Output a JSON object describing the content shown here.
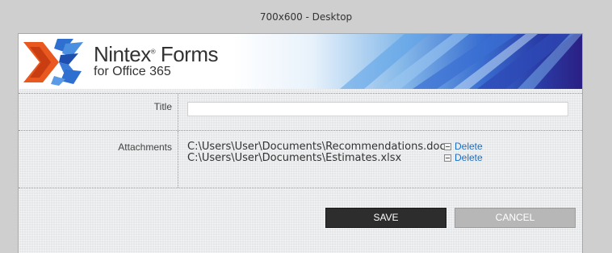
{
  "device_label": "700x600 - Desktop",
  "banner": {
    "brand_title": "Nintex",
    "brand_title_suffix": "Forms",
    "brand_subtitle": "for Office 365",
    "colors": {
      "accent_orange": "#e8581f",
      "accent_blue": "#2f6fd0",
      "deep_blue": "#2a1f83"
    }
  },
  "form": {
    "title_label": "Title",
    "title_value": "",
    "attachments_label": "Attachments",
    "attachments": [
      {
        "path": "C:\\Users\\User\\Documents\\Recommendations.docx",
        "delete_label": "Delete"
      },
      {
        "path": "C:\\Users\\User\\Documents\\Estimates.xlsx",
        "delete_label": "Delete"
      }
    ]
  },
  "buttons": {
    "save_label": "SAVE",
    "cancel_label": "CANCEL"
  }
}
